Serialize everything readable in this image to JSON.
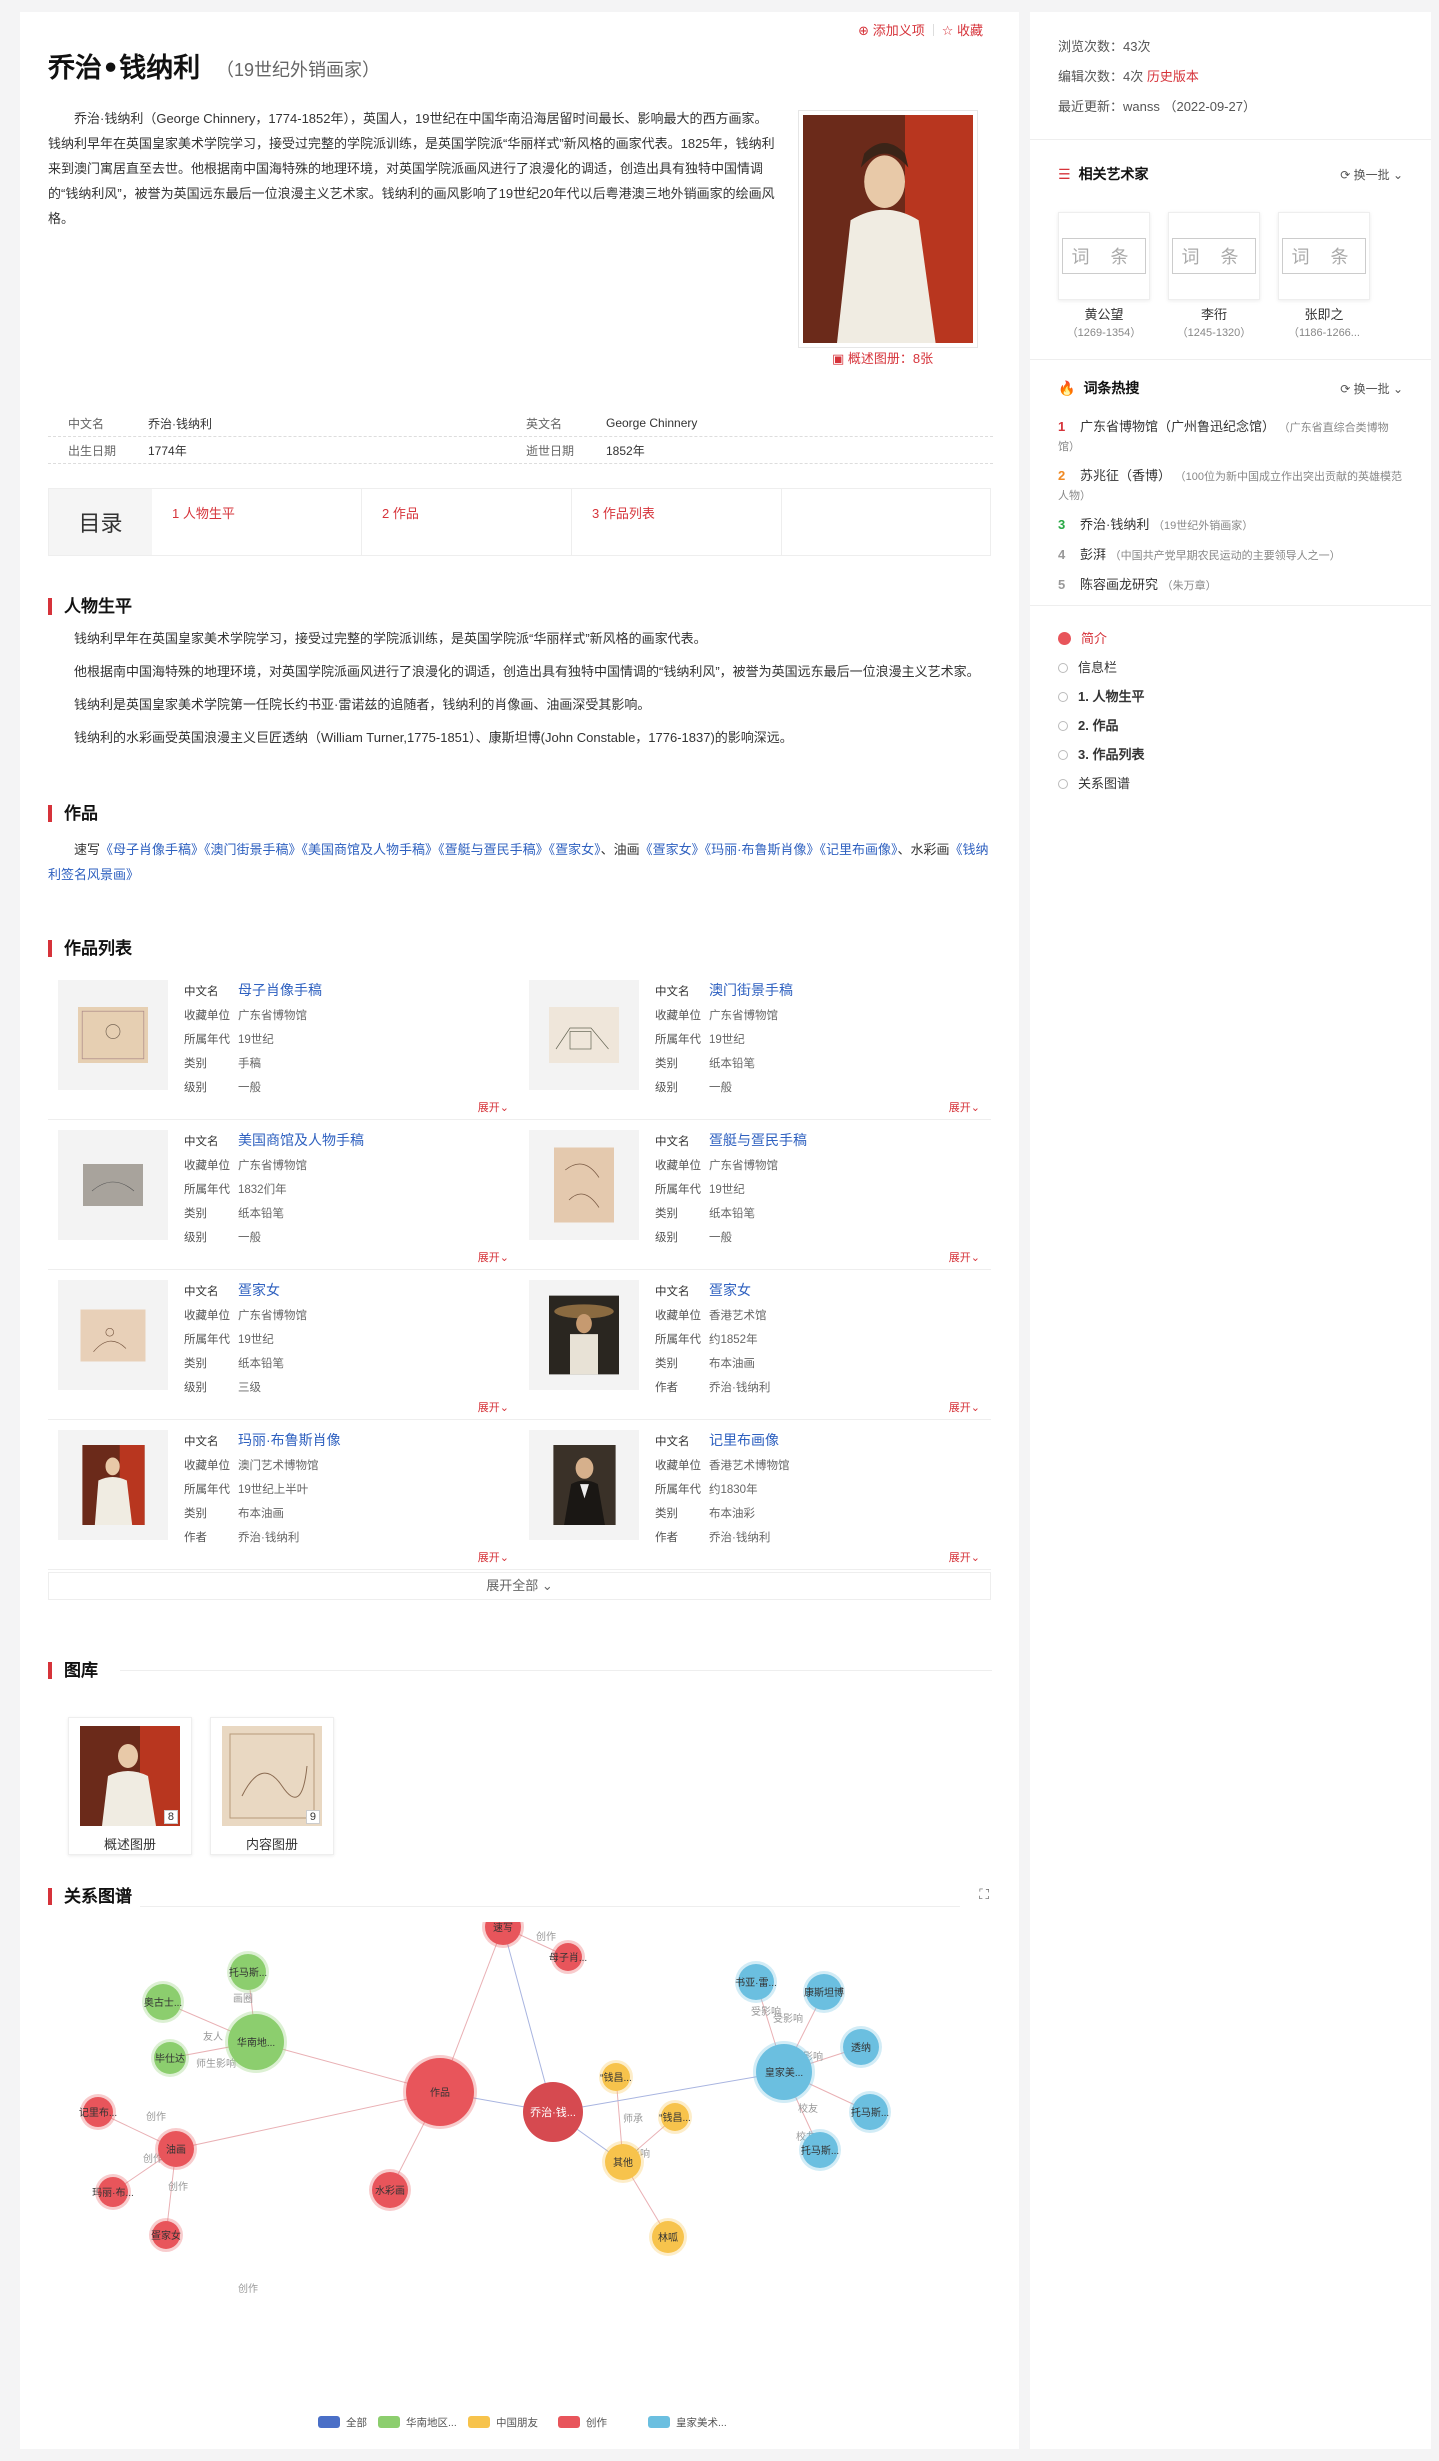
{
  "header": {
    "title": "乔治•钱纳利",
    "subtitle": "（19世纪外销画家）",
    "add_item": "添加义项",
    "favorite": "收藏"
  },
  "summary": "乔治·钱纳利（George Chinnery，1774-1852年），英国人，19世纪在中国华南沿海居留时间最长、影响最大的西方画家。钱纳利早年在英国皇家美术学院学习，接受过完整的学院派训练，是英国学院派“华丽样式”新风格的画家代表。1825年，钱纳利来到澳门寓居直至去世。他根据南中国海特殊的地理环境，对英国学院派画风进行了浪漫化的调适，创造出具有独特中国情调的“钱纳利风”，被誉为英国远东最后一位浪漫主义艺术家。钱纳利的画风影响了19世纪20年代以后粤港澳三地外销画家的绘画风格。",
  "summary_album": "概述图册：8张",
  "infobox": [
    {
      "k1": "中文名",
      "v1": "乔治·钱纳利",
      "k2": "英文名",
      "v2": "George Chinnery"
    },
    {
      "k1": "出生日期",
      "v1": "1774年",
      "k2": "逝世日期",
      "v2": "1852年"
    }
  ],
  "toc": {
    "head": "目录",
    "items": [
      "1 人物生平",
      "2 作品",
      "3 作品列表"
    ]
  },
  "life": {
    "title": "人物生平",
    "paras": [
      "钱纳利早年在英国皇家美术学院学习，接受过完整的学院派训练，是英国学院派“华丽样式”新风格的画家代表。",
      "他根据南中国海特殊的地理环境，对英国学院派画风进行了浪漫化的调适，创造出具有独特中国情调的“钱纳利风”，被誉为英国远东最后一位浪漫主义艺术家。",
      "钱纳利是英国皇家美术学院第一任院长约书亚·雷诺兹的追随者，钱纳利的肖像画、油画深受其影响。",
      "钱纳利的水彩画受英国浪漫主义巨匠透纳（William Turner,1775-1851）、康斯坦博(John Constable，1776-1837)的影响深远。"
    ]
  },
  "works": {
    "title": "作品",
    "p1": "速写",
    "links1": [
      "《母子肖像手稿》",
      "《澳门街景手稿》",
      "《美国商馆及人物手稿》",
      "《疍艇与疍民手稿》",
      "《疍家女》"
    ],
    "p2": "、油画",
    "links2": [
      "《疍家女》",
      "《玛丽·布鲁斯肖像》",
      "《记里布画像》"
    ],
    "p3": "、水彩画",
    "links3": [
      "《钱纳利签名风景画》"
    ]
  },
  "work_list": {
    "title": "作品列表",
    "expand": "展开",
    "expand_all": "展开全部",
    "items": [
      {
        "name": "母子肖像手稿",
        "f": [
          [
            "收藏单位",
            "广东省博物馆"
          ],
          [
            "所属年代",
            "19世纪"
          ],
          [
            "类别",
            "手稿"
          ],
          [
            "级别",
            "一般"
          ]
        ]
      },
      {
        "name": "澳门街景手稿",
        "f": [
          [
            "收藏单位",
            "广东省博物馆"
          ],
          [
            "所属年代",
            "19世纪"
          ],
          [
            "类别",
            "纸本铅笔"
          ],
          [
            "级别",
            "一般"
          ]
        ]
      },
      {
        "name": "美国商馆及人物手稿",
        "f": [
          [
            "收藏单位",
            "广东省博物馆"
          ],
          [
            "所属年代",
            "1832们年"
          ],
          [
            "类别",
            "纸本铅笔"
          ],
          [
            "级别",
            "一般"
          ]
        ]
      },
      {
        "name": "疍艇与疍民手稿",
        "f": [
          [
            "收藏单位",
            "广东省博物馆"
          ],
          [
            "所属年代",
            "19世纪"
          ],
          [
            "类别",
            "纸本铅笔"
          ],
          [
            "级别",
            "一般"
          ]
        ]
      },
      {
        "name": "疍家女",
        "f": [
          [
            "收藏单位",
            "广东省博物馆"
          ],
          [
            "所属年代",
            "19世纪"
          ],
          [
            "类别",
            "纸本铅笔"
          ],
          [
            "级别",
            "三级"
          ]
        ]
      },
      {
        "name": "疍家女",
        "f": [
          [
            "收藏单位",
            "香港艺术馆"
          ],
          [
            "所属年代",
            "约1852年"
          ],
          [
            "类别",
            "布本油画"
          ],
          [
            "作者",
            "乔治·钱纳利"
          ]
        ]
      },
      {
        "name": "玛丽·布鲁斯肖像",
        "f": [
          [
            "收藏单位",
            "澳门艺术博物馆"
          ],
          [
            "所属年代",
            "19世纪上半叶"
          ],
          [
            "类别",
            "布本油画"
          ],
          [
            "作者",
            "乔治·钱纳利"
          ]
        ]
      },
      {
        "name": "记里布画像",
        "f": [
          [
            "收藏单位",
            "香港艺术博物馆"
          ],
          [
            "所属年代",
            "约1830年"
          ],
          [
            "类别",
            "布本油彩"
          ],
          [
            "作者",
            "乔治·钱纳利"
          ]
        ]
      }
    ],
    "name_label": "中文名"
  },
  "gallery": {
    "title": "图库",
    "items": [
      {
        "label": "概述图册",
        "count": "8"
      },
      {
        "label": "内容图册",
        "count": "9"
      }
    ]
  },
  "graph": {
    "title": "关系图谱",
    "center": "乔治·钱...",
    "nodes": [
      {
        "label": "速写",
        "group": "red"
      },
      {
        "label": "母子肖...",
        "group": "red"
      },
      {
        "label": "作品",
        "group": "red"
      },
      {
        "label": "油画",
        "group": "red"
      },
      {
        "label": "水彩画",
        "group": "red"
      },
      {
        "label": "记里布...",
        "group": "red"
      },
      {
        "label": "玛丽·布...",
        "group": "red"
      },
      {
        "label": "疍家女",
        "group": "red"
      },
      {
        "label": "托马斯...",
        "group": "green"
      },
      {
        "label": "奥古士...",
        "group": "green"
      },
      {
        "label": "华南地...",
        "group": "green"
      },
      {
        "label": "毕仕达",
        "group": "green"
      },
      {
        "label": "“钱昌...",
        "group": "yellow"
      },
      {
        "label": "“钱昌...",
        "group": "yellow"
      },
      {
        "label": "其他",
        "group": "yellow"
      },
      {
        "label": "林呱",
        "group": "yellow"
      },
      {
        "label": "书亚·雷...",
        "group": "blue"
      },
      {
        "label": "康斯坦博",
        "group": "blue"
      },
      {
        "label": "皇家美...",
        "group": "blue"
      },
      {
        "label": "透纳",
        "group": "blue"
      },
      {
        "label": "托马斯...",
        "group": "blue"
      },
      {
        "label": "托马斯...",
        "group": "blue"
      }
    ],
    "edge_labels": [
      "创作",
      "画圈",
      "友人",
      "师生影响",
      "创作",
      "创作",
      "创作",
      "创作",
      "受影响",
      "受影响",
      "受影响",
      "校友",
      "校友",
      "师承",
      "影响"
    ],
    "legend": [
      {
        "label": "全部",
        "color": "#4a6fc7"
      },
      {
        "label": "华南地区...",
        "color": "#8cce6e"
      },
      {
        "label": "中国朋友",
        "color": "#f7c34c"
      },
      {
        "label": "创作",
        "color": "#e8555b"
      },
      {
        "label": "皇家美术...",
        "color": "#6bbfe0"
      }
    ],
    "colors": {
      "red": "#e8555b",
      "green": "#8cce6e",
      "yellow": "#f7c34c",
      "blue": "#6bbfe0"
    }
  },
  "sidebar": {
    "stats": [
      {
        "k": "浏览次数：",
        "v": "43次"
      },
      {
        "k": "编辑次数：",
        "v": "4次",
        "extra": "历史版本"
      },
      {
        "k": "最近更新：",
        "v": "wanss （2022-09-27）"
      }
    ],
    "related": {
      "title": "相关艺术家",
      "refresh": "换一批",
      "items": [
        {
          "name": "黄公望",
          "years": "（1269-1354）"
        },
        {
          "name": "李衎",
          "years": "（1245-1320）"
        },
        {
          "name": "张即之",
          "years": "（1186-1266..."
        }
      ],
      "placeholder": "词 条"
    },
    "hot": {
      "title": "词条热搜",
      "refresh": "换一批",
      "items": [
        {
          "n": "1",
          "t": "广东省博物馆（广州鲁迅纪念馆）",
          "d": "（广东省直综合类博物馆）",
          "c": "#d6333a"
        },
        {
          "n": "2",
          "t": "苏兆征（香博）",
          "d": "（100位为新中国成立作出突出贡献的英雄模范人物）",
          "c": "#f08a24"
        },
        {
          "n": "3",
          "t": "乔治·钱纳利",
          "d": "（19世纪外销画家）",
          "c": "#27a844"
        },
        {
          "n": "4",
          "t": "彭湃",
          "d": "（中国共产党早期农民运动的主要领导人之一）",
          "c": "#999"
        },
        {
          "n": "5",
          "t": "陈容画龙研究",
          "d": "（朱万章）",
          "c": "#999"
        }
      ]
    },
    "outline": [
      "简介",
      "信息栏",
      "1. 人物生平",
      "2. 作品",
      "3. 作品列表",
      "关系图谱"
    ]
  }
}
